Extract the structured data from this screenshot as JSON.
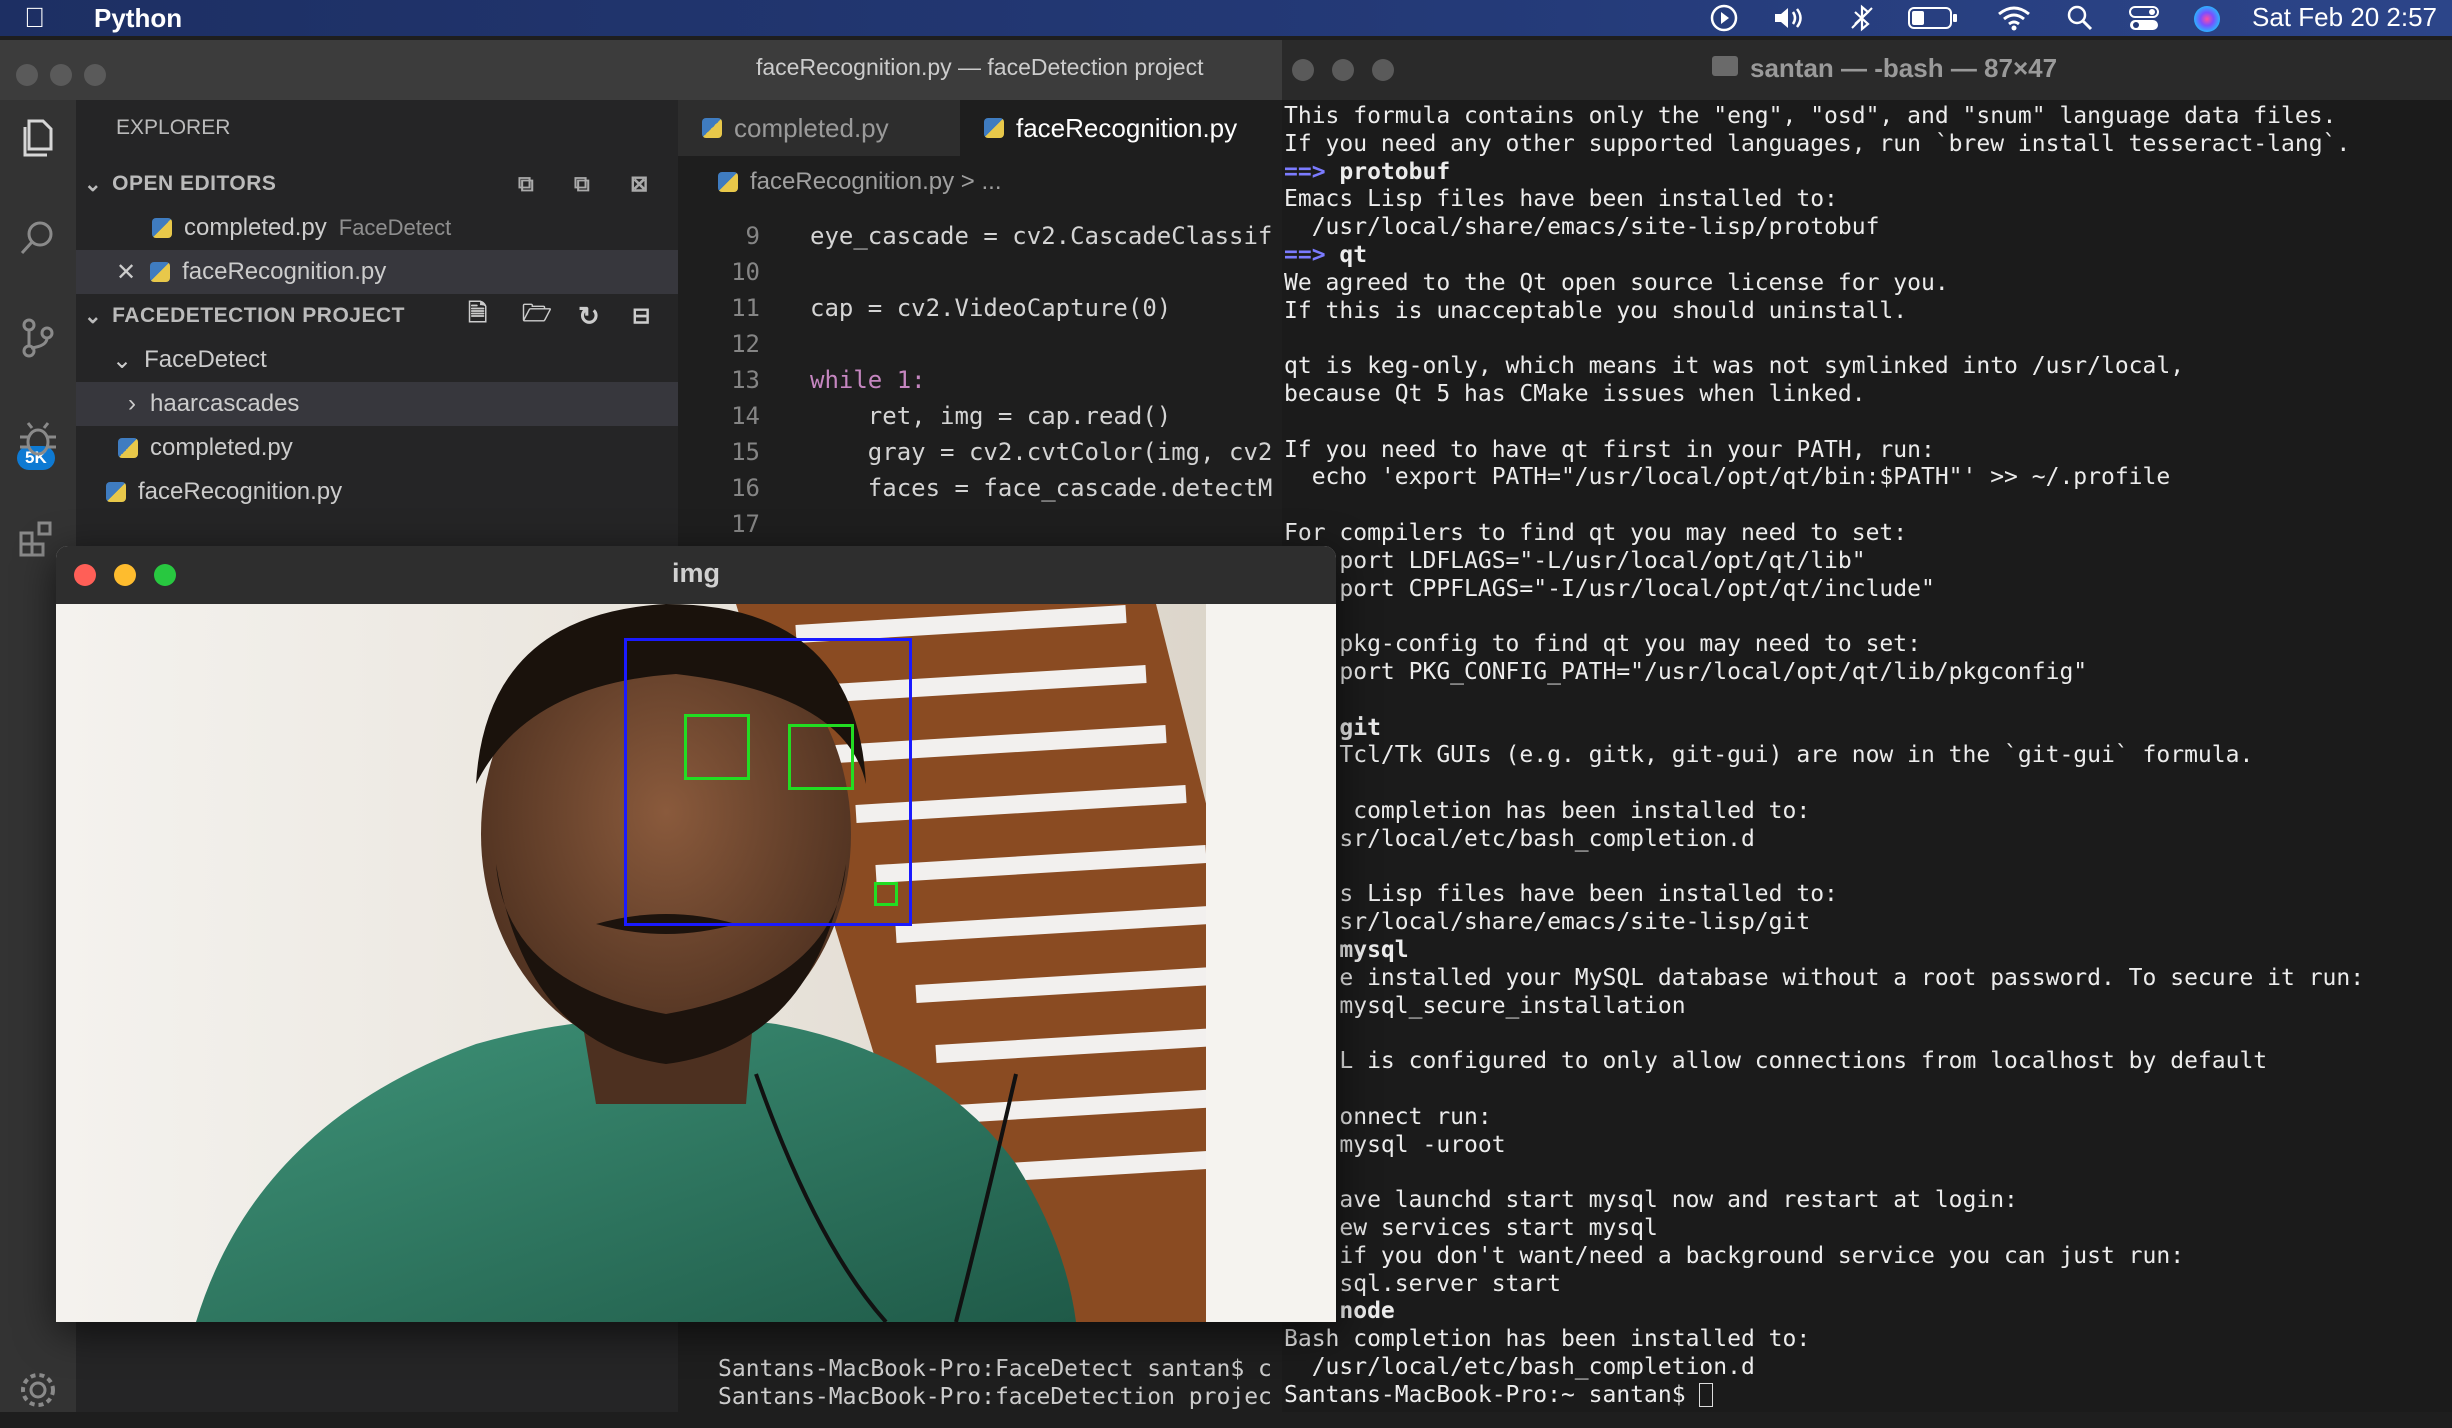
{
  "menubar": {
    "app_name": "Python",
    "clock": "Sat Feb 20  2:57",
    "icons": [
      "apple-icon",
      "play-circle-icon",
      "volume-icon",
      "bluetooth-icon",
      "battery-icon",
      "wifi-icon",
      "search-icon",
      "control-center-icon",
      "siri-icon"
    ]
  },
  "vscode": {
    "window_title": "faceRecognition.py — faceDetection project",
    "explorer_title": "EXPLORER",
    "open_editors_label": "OPEN EDITORS",
    "open_editors": [
      {
        "name": "completed.py",
        "hint": "FaceDetect",
        "active": false
      },
      {
        "name": "faceRecognition.py",
        "hint": "",
        "active": true
      }
    ],
    "project_label": "FACEDETECTION PROJECT",
    "tree": [
      {
        "name": "FaceDetect",
        "type": "folder-open"
      },
      {
        "name": "haarcascades",
        "type": "folder-closed"
      },
      {
        "name": "completed.py",
        "type": "file"
      },
      {
        "name": "faceRecognition.py",
        "type": "file"
      }
    ],
    "source_control_badge": "5K",
    "tabs": [
      {
        "label": "completed.py",
        "active": false
      },
      {
        "label": "faceRecognition.py",
        "active": true
      }
    ],
    "breadcrumb": "faceRecognition.py  >  ...",
    "code_lines": [
      {
        "num": "9",
        "text": "eye_cascade = cv2.CascadeClassif"
      },
      {
        "num": "10",
        "text": ""
      },
      {
        "num": "11",
        "text": "cap = cv2.VideoCapture(0)"
      },
      {
        "num": "12",
        "text": ""
      },
      {
        "num": "13",
        "text": "while 1:"
      },
      {
        "num": "14",
        "text": "    ret, img = cap.read()"
      },
      {
        "num": "15",
        "text": "    gray = cv2.cvtColor(img, cv2"
      },
      {
        "num": "16",
        "text": "    faces = face_cascade.detectM"
      },
      {
        "num": "17",
        "text": ""
      }
    ],
    "terminal_lines": [
      "Santans-MacBook-Pro:FaceDetect santan$ c",
      "Santans-MacBook-Pro:faceDetection projec"
    ]
  },
  "terminal": {
    "title": "santan — -bash — 87×47",
    "lines": [
      {
        "text": "This formula contains only the \"eng\", \"osd\", and \"snum\" language data files.",
        "style": ""
      },
      {
        "text": "If you need any other supported languages, run `brew install tesseract-lang`.",
        "style": ""
      },
      {
        "text": "==> protobuf",
        "style": "header"
      },
      {
        "text": "Emacs Lisp files have been installed to:",
        "style": ""
      },
      {
        "text": "  /usr/local/share/emacs/site-lisp/protobuf",
        "style": ""
      },
      {
        "text": "==> qt",
        "style": "header"
      },
      {
        "text": "We agreed to the Qt open source license for you.",
        "style": ""
      },
      {
        "text": "If this is unacceptable you should uninstall.",
        "style": ""
      },
      {
        "text": "",
        "style": ""
      },
      {
        "text": "qt is keg-only, which means it was not symlinked into /usr/local,",
        "style": ""
      },
      {
        "text": "because Qt 5 has CMake issues when linked.",
        "style": ""
      },
      {
        "text": "",
        "style": ""
      },
      {
        "text": "If you need to have qt first in your PATH, run:",
        "style": ""
      },
      {
        "text": "  echo 'export PATH=\"/usr/local/opt/qt/bin:$PATH\"' >> ~/.profile",
        "style": ""
      },
      {
        "text": "",
        "style": ""
      },
      {
        "text": "For compilers to find qt you may need to set:",
        "style": ""
      },
      {
        "text": "    port LDFLAGS=\"-L/usr/local/opt/qt/lib\"",
        "style": ""
      },
      {
        "text": "    port CPPFLAGS=\"-I/usr/local/opt/qt/include\"",
        "style": ""
      },
      {
        "text": "",
        "style": ""
      },
      {
        "text": "    pkg-config to find qt you may need to set:",
        "style": ""
      },
      {
        "text": "    port PKG_CONFIG_PATH=\"/usr/local/opt/qt/lib/pkgconfig\"",
        "style": ""
      },
      {
        "text": "",
        "style": ""
      },
      {
        "text": "    git",
        "style": "bold"
      },
      {
        "text": "    Tcl/Tk GUIs (e.g. gitk, git-gui) are now in the `git-gui` formula.",
        "style": ""
      },
      {
        "text": "",
        "style": ""
      },
      {
        "text": "     completion has been installed to:",
        "style": ""
      },
      {
        "text": "    sr/local/etc/bash_completion.d",
        "style": ""
      },
      {
        "text": "",
        "style": ""
      },
      {
        "text": "    s Lisp files have been installed to:",
        "style": ""
      },
      {
        "text": "    sr/local/share/emacs/site-lisp/git",
        "style": ""
      },
      {
        "text": "    mysql",
        "style": "bold"
      },
      {
        "text": "    e installed your MySQL database without a root password. To secure it run:",
        "style": ""
      },
      {
        "text": "    mysql_secure_installation",
        "style": ""
      },
      {
        "text": "",
        "style": ""
      },
      {
        "text": "    L is configured to only allow connections from localhost by default",
        "style": ""
      },
      {
        "text": "",
        "style": ""
      },
      {
        "text": "    onnect run:",
        "style": ""
      },
      {
        "text": "    mysql -uroot",
        "style": ""
      },
      {
        "text": "",
        "style": ""
      },
      {
        "text": "    ave launchd start mysql now and restart at login:",
        "style": ""
      },
      {
        "text": "    ew services start mysql",
        "style": ""
      },
      {
        "text": "    if you don't want/need a background service you can just run:",
        "style": ""
      },
      {
        "text": "    sql.server start",
        "style": ""
      },
      {
        "text": "    node",
        "style": "bold"
      },
      {
        "text": "Bash completion has been installed to:",
        "style": ""
      },
      {
        "text": "  /usr/local/etc/bash_completion.d",
        "style": ""
      },
      {
        "text": "Santans-MacBook-Pro:~ santan$ ",
        "style": "prompt"
      }
    ]
  },
  "img_window": {
    "title": "img",
    "face_box_color": "#1a1aff",
    "eye_box_color": "#22dd22"
  }
}
